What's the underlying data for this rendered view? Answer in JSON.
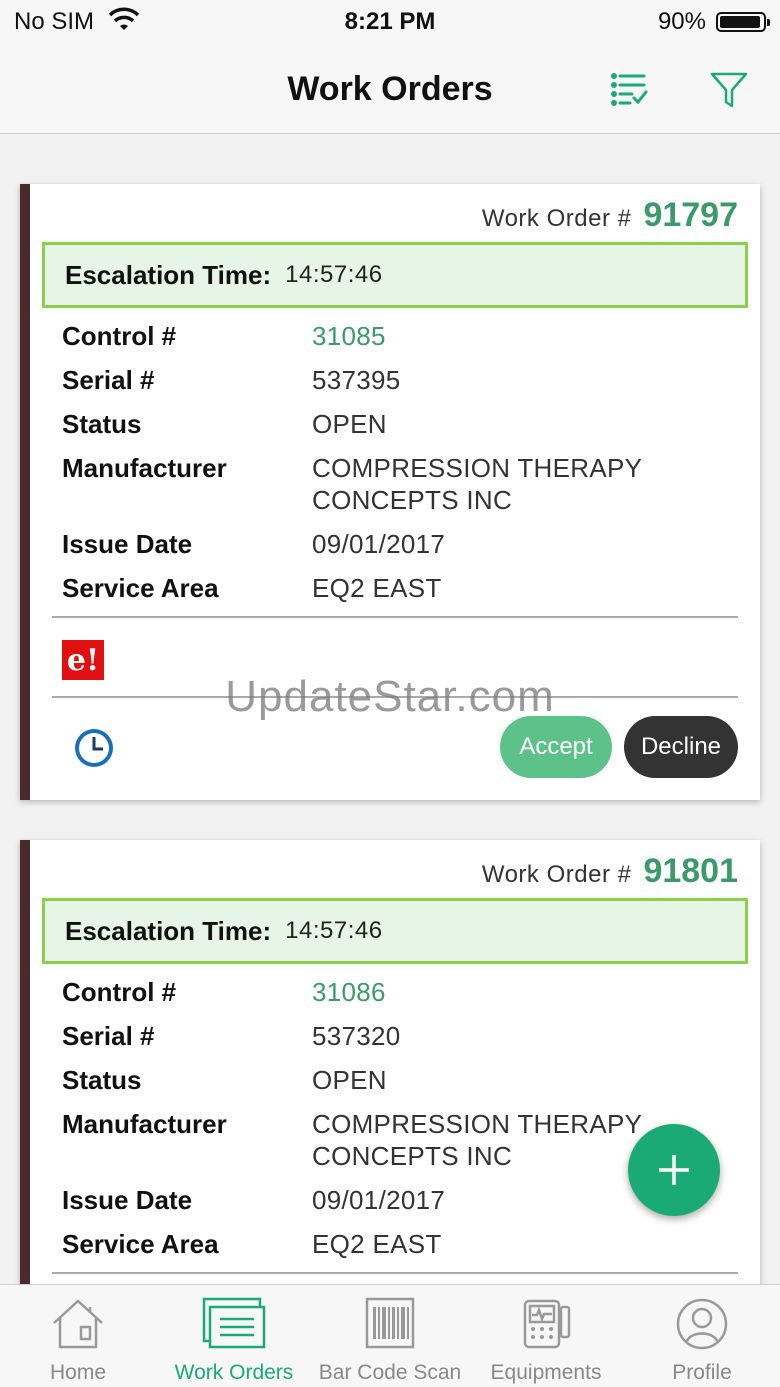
{
  "status_bar": {
    "carrier": "No SIM",
    "time": "8:21 PM",
    "battery": "90%"
  },
  "nav": {
    "title": "Work Orders",
    "list_icon": "checklist-icon",
    "filter_icon": "filter-icon"
  },
  "colors": {
    "accent": "#3a9a6a",
    "escalation_bg": "#e6f5e6",
    "escalation_border": "#8ad04a",
    "card_edge": "#4a2a2a",
    "fab": "#1aaa78",
    "decline": "#333333",
    "accept": "#5cc28a"
  },
  "labels": {
    "work_order": "Work Order #",
    "escalation": "Escalation Time:",
    "control": "Control #",
    "serial": "Serial #",
    "status": "Status",
    "manufacturer": "Manufacturer",
    "issue_date": "Issue Date",
    "service_area": "Service Area",
    "accept": "Accept",
    "decline": "Decline"
  },
  "work_orders": [
    {
      "number": "91797",
      "escalation_time": "14:57:46",
      "control": "31085",
      "serial": "537395",
      "status": "OPEN",
      "manufacturer_line1": "COMPRESSION THERAPY",
      "manufacturer_line2": "CONCEPTS INC",
      "issue_date": "09/01/2017",
      "service_area": "EQ2 EAST",
      "badge": "e!"
    },
    {
      "number": "91801",
      "escalation_time": "14:57:46",
      "control": "31086",
      "serial": "537320",
      "status": "OPEN",
      "manufacturer_line1": "COMPRESSION THERAPY",
      "manufacturer_line2": "CONCEPTS INC",
      "issue_date": "09/01/2017",
      "service_area": "EQ2 EAST"
    }
  ],
  "watermark": "UpdateStar.com",
  "tabs": [
    {
      "label": "Home",
      "icon": "home-icon",
      "active": false
    },
    {
      "label": "Work Orders",
      "icon": "work-orders-icon",
      "active": true
    },
    {
      "label": "Bar Code Scan",
      "icon": "barcode-icon",
      "active": false
    },
    {
      "label": "Equipments",
      "icon": "equipment-icon",
      "active": false
    },
    {
      "label": "Profile",
      "icon": "profile-icon",
      "active": false
    }
  ]
}
